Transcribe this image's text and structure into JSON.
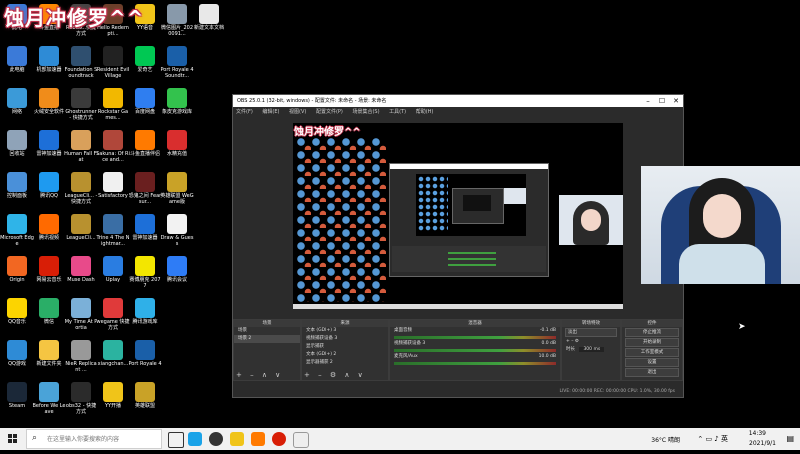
{
  "overlay_title": "蚀月冲修罗^^",
  "desktop_icons": [
    {
      "label": "此电",
      "x": 0,
      "y": 0,
      "color": "#3b7ad8"
    },
    {
      "label": "斗鱼直播",
      "x": 1,
      "y": 0,
      "color": "#ff8a00"
    },
    {
      "label": "Roblox..快捷方式",
      "x": 2,
      "y": 0,
      "color": "#444444"
    },
    {
      "label": "Hello Redempti...",
      "x": 3,
      "y": 0,
      "color": "#6b3f2a"
    },
    {
      "label": "YY语音",
      "x": 4,
      "y": 0,
      "color": "#f0c419"
    },
    {
      "label": "微信图片_2020091...",
      "x": 5,
      "y": 0,
      "color": "#8899aa"
    },
    {
      "label": "新建文本文档",
      "x": 6,
      "y": 0,
      "color": "#e8e8e8"
    },
    {
      "label": "此电脑",
      "x": 0,
      "y": 1,
      "color": "#3b7ad8"
    },
    {
      "label": "机部加速器",
      "x": 1,
      "y": 1,
      "color": "#2e8bd6"
    },
    {
      "label": "Foundation Soundtrack",
      "x": 2,
      "y": 1,
      "color": "#2f4f6f"
    },
    {
      "label": "Resident Evil Village",
      "x": 3,
      "y": 1,
      "color": "#222222"
    },
    {
      "label": "爱奇艺",
      "x": 4,
      "y": 1,
      "color": "#00c853"
    },
    {
      "label": "Port Royale 4 Soundtr...",
      "x": 5,
      "y": 1,
      "color": "#1a5fa8"
    },
    {
      "label": "网络",
      "x": 0,
      "y": 2,
      "color": "#3b9ad8"
    },
    {
      "label": "火绒安全软件",
      "x": 1,
      "y": 2,
      "color": "#f08c1a"
    },
    {
      "label": "Ghostrunner - 快捷方式",
      "x": 2,
      "y": 2,
      "color": "#3a3a3a"
    },
    {
      "label": "Rockstar Games...",
      "x": 3,
      "y": 2,
      "color": "#f2b800"
    },
    {
      "label": "百度网盘",
      "x": 4,
      "y": 2,
      "color": "#2f7ef0"
    },
    {
      "label": "象皮克游戏库",
      "x": 5,
      "y": 2,
      "color": "#33c24d"
    },
    {
      "label": "回收站",
      "x": 0,
      "y": 3,
      "color": "#8fa3b8"
    },
    {
      "label": "雷神加速器",
      "x": 1,
      "y": 3,
      "color": "#1d6fd8"
    },
    {
      "label": "Human Fall Flat",
      "x": 2,
      "y": 3,
      "color": "#d9a05b"
    },
    {
      "label": "Sakuna: Of Rice and...",
      "x": 3,
      "y": 3,
      "color": "#b0473a"
    },
    {
      "label": "斗鱼直播伴侣",
      "x": 4,
      "y": 3,
      "color": "#ff7a00"
    },
    {
      "label": "水精充值",
      "x": 5,
      "y": 3,
      "color": "#d92e2e"
    },
    {
      "label": "控制面板",
      "x": 0,
      "y": 4,
      "color": "#4a90d9"
    },
    {
      "label": "腾讯QQ",
      "x": 1,
      "y": 4,
      "color": "#1e9af0"
    },
    {
      "label": "LeagueCli... - 快捷方式",
      "x": 2,
      "y": 4,
      "color": "#b8912f"
    },
    {
      "label": "Satisfactory",
      "x": 3,
      "y": 4,
      "color": "#f0f0f0"
    },
    {
      "label": "恐鬼之间 Fear sur...",
      "x": 4,
      "y": 4,
      "color": "#6a1f1f"
    },
    {
      "label": "英雄联盟 WeGame版",
      "x": 5,
      "y": 4,
      "color": "#c9a227"
    },
    {
      "label": "Microsoft Edge",
      "x": 0,
      "y": 5,
      "color": "#2fb4e8"
    },
    {
      "label": "腾讯视频",
      "x": 1,
      "y": 5,
      "color": "#ff6a00"
    },
    {
      "label": "LeagueCli...",
      "x": 2,
      "y": 5,
      "color": "#b8912f"
    },
    {
      "label": "Trine 4 The Nightmar...",
      "x": 3,
      "y": 5,
      "color": "#3a6ea5"
    },
    {
      "label": "雷神加速器",
      "x": 4,
      "y": 5,
      "color": "#1d6fd8"
    },
    {
      "label": "Draw & Guess",
      "x": 5,
      "y": 5,
      "color": "#f2f2f2"
    },
    {
      "label": "Origin",
      "x": 0,
      "y": 6,
      "color": "#f26722"
    },
    {
      "label": "网易云音乐",
      "x": 1,
      "y": 6,
      "color": "#d81e06"
    },
    {
      "label": "Muse Dash",
      "x": 2,
      "y": 6,
      "color": "#e84a8a"
    },
    {
      "label": "Uplay",
      "x": 3,
      "y": 6,
      "color": "#2a7de1"
    },
    {
      "label": "赛博朋克 2077",
      "x": 4,
      "y": 6,
      "color": "#f3e600"
    },
    {
      "label": "腾讯会议",
      "x": 5,
      "y": 6,
      "color": "#2e7cf6"
    },
    {
      "label": "QQ音乐",
      "x": 0,
      "y": 7,
      "color": "#fcd400"
    },
    {
      "label": "微信",
      "x": 1,
      "y": 7,
      "color": "#2aae67"
    },
    {
      "label": "My Time At Portia",
      "x": 2,
      "y": 7,
      "color": "#7bb0d8"
    },
    {
      "label": "wegame 快捷方式",
      "x": 3,
      "y": 7,
      "color": "#e03a3a"
    },
    {
      "label": "腾讯游戏库",
      "x": 4,
      "y": 7,
      "color": "#2fb0e8"
    },
    {
      "label": "QQ游戏",
      "x": 0,
      "y": 8,
      "color": "#2e8bd6"
    },
    {
      "label": "新建文件夹",
      "x": 1,
      "y": 8,
      "color": "#f5c542"
    },
    {
      "label": "NieR Replicant ...",
      "x": 2,
      "y": 8,
      "color": "#999999"
    },
    {
      "label": "xiangchan...",
      "x": 3,
      "y": 8,
      "color": "#2bb3a0"
    },
    {
      "label": "Port Royale 4",
      "x": 4,
      "y": 8,
      "color": "#1a5fa8"
    },
    {
      "label": "Steam",
      "x": 0,
      "y": 9,
      "color": "#1b2838"
    },
    {
      "label": "Before We Leave",
      "x": 1,
      "y": 9,
      "color": "#4aa3d8"
    },
    {
      "label": "obs32 - 快捷方式",
      "x": 2,
      "y": 9,
      "color": "#2b2b2b"
    },
    {
      "label": "YY开播",
      "x": 3,
      "y": 9,
      "color": "#f0c419"
    },
    {
      "label": "英雄联盟",
      "x": 4,
      "y": 9,
      "color": "#c9a227"
    }
  ],
  "obs": {
    "title": "OBS 25.0.1 (32-bit, windows) - 配置文件: 未命名 - 场景: 未命名",
    "menu": [
      "文件(F)",
      "编辑(E)",
      "视图(V)",
      "配置文件(P)",
      "场景集合(S)",
      "工具(T)",
      "帮助(H)"
    ],
    "docks": {
      "scenes": {
        "header": "场景",
        "items": [
          "场景",
          "场景 2"
        ]
      },
      "sources": {
        "header": "来源",
        "items": [
          "文本 (GDI+) 3",
          "视频捕获设备 3",
          "显示捕获",
          "文本 (GDI+) 2",
          "显示器捕获 2"
        ]
      },
      "mixer": {
        "header": "混音器",
        "channels": [
          {
            "name": "桌面音频",
            "db": "-0.1 dB"
          },
          {
            "name": "视频捕获设备 3",
            "db": "0.0 dB"
          },
          {
            "name": "麦克风/Aux",
            "db": "10.0 dB"
          }
        ]
      },
      "transitions": {
        "header": "转场特效",
        "type": "淡出",
        "duration_label": "时长",
        "duration": "300 ms"
      },
      "controls": {
        "header": "控件",
        "buttons": [
          "停止推流",
          "开始录制",
          "工作室模式",
          "设置",
          "退出"
        ]
      }
    },
    "status": "LIVE: 00:00:00   REC: 00:00:00   CPU: 1.0%, 30.00 fps"
  },
  "taskbar": {
    "search_placeholder": "在这里输入你要搜索的内容",
    "weather": "36°C 晴朗",
    "time": "14:39",
    "date": "2021/9/1"
  }
}
